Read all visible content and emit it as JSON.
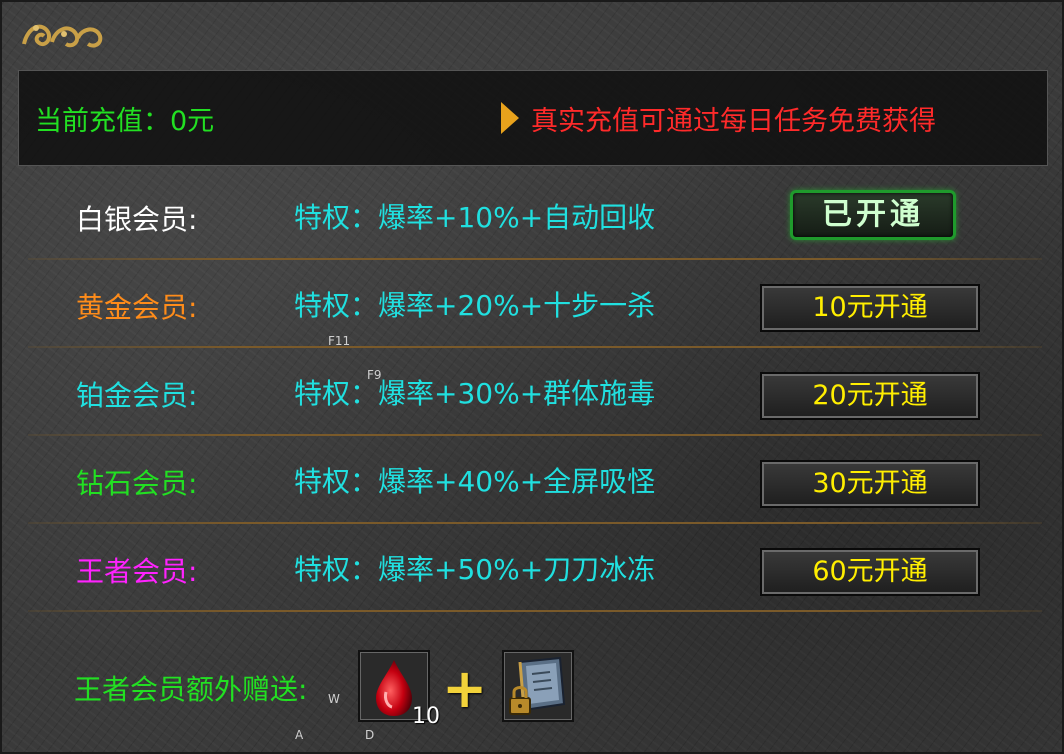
{
  "header": {
    "recharge_text": "当前充值：0元",
    "notice_text": "真实充值可通过每日任务免费获得"
  },
  "tiers": [
    {
      "name": "白银会员:",
      "privilege": "特权：爆率+10%+自动回收",
      "button": "已开通",
      "name_color": "#ffffff",
      "state": "opened"
    },
    {
      "name": "黄金会员:",
      "privilege": "特权：爆率+20%+十步一杀",
      "button": "10元开通",
      "name_color": "#ff8c1a",
      "state": "buy"
    },
    {
      "name": "铂金会员:",
      "privilege": "特权：爆率+30%+群体施毒",
      "button": "20元开通",
      "name_color": "#20e0e0",
      "state": "buy"
    },
    {
      "name": "钻石会员:",
      "privilege": "特权：爆率+40%+全屏吸怪",
      "button": "30元开通",
      "name_color": "#22e022",
      "state": "buy"
    },
    {
      "name": "王者会员:",
      "privilege": "特权：爆率+50%+刀刀冰冻",
      "button": "60元开通",
      "name_color": "#ff22ff",
      "state": "buy"
    }
  ],
  "bonus": {
    "label": "王者会员额外赠送:",
    "items": [
      {
        "icon": "blood-drop-icon",
        "quantity": "10"
      },
      {
        "icon": "locked-book-icon"
      }
    ],
    "plus": "+"
  },
  "hotkeys": {
    "f11": "F11",
    "f9": "F9",
    "w": "W",
    "a": "A",
    "d": "D"
  },
  "colors": {
    "privilege": "#20e0e0",
    "button_text": "#ffee00",
    "recharge": "#22e022",
    "notice": "#ff2a2a"
  }
}
